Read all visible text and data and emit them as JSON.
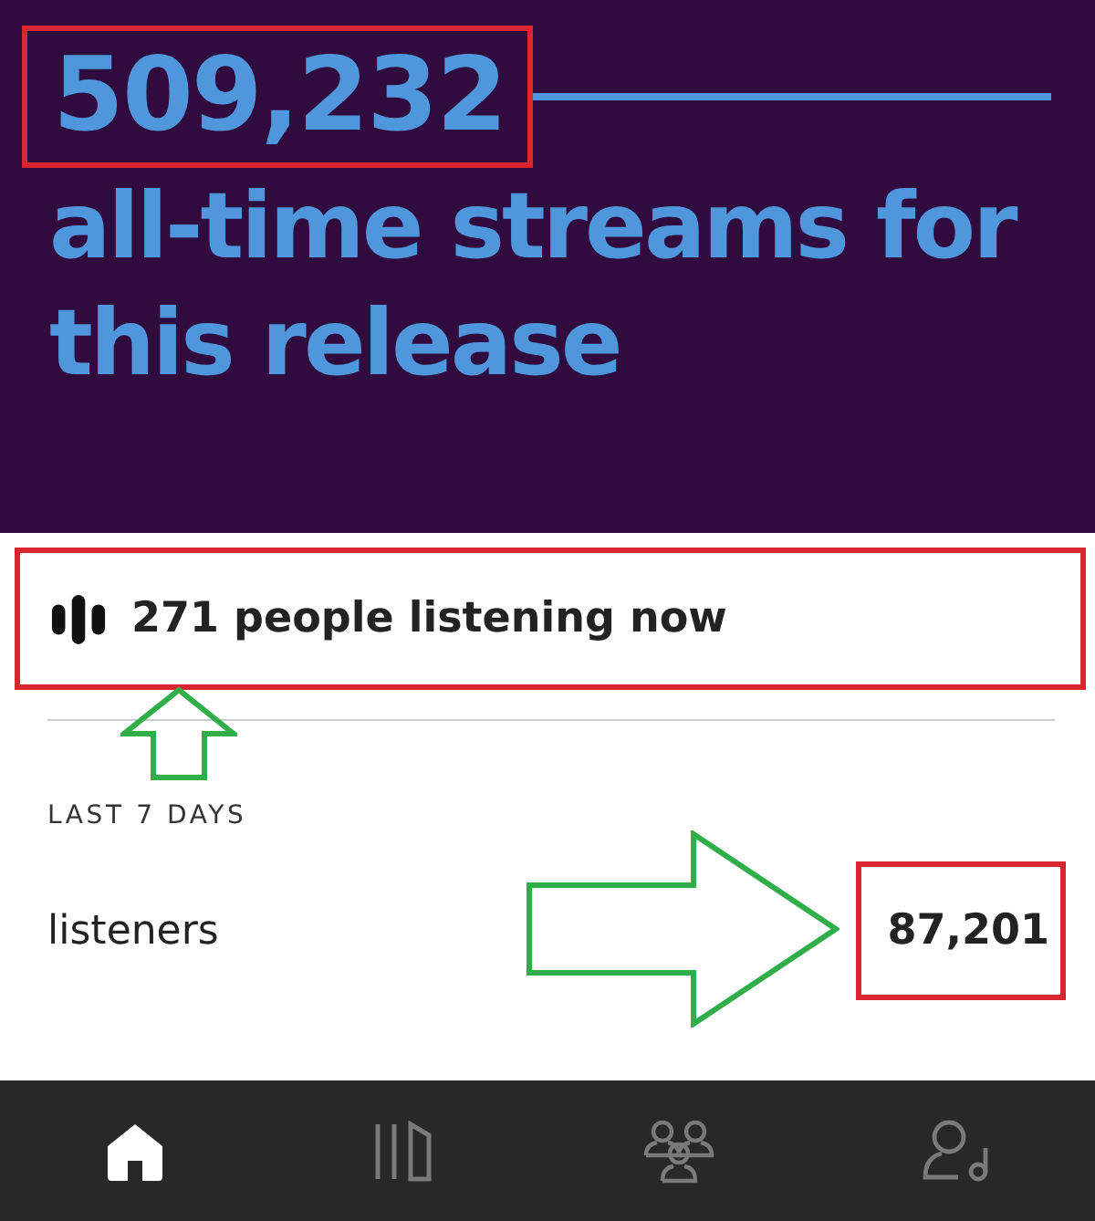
{
  "hero": {
    "count": "509,232",
    "count_highlighted": true,
    "caption": "all-time streams for this release"
  },
  "live": {
    "text": "271 people listening now",
    "highlighted": true,
    "arrow_below": true
  },
  "period": "LAST 7 DAYS",
  "stats": [
    {
      "label": "listeners",
      "value": "87,201",
      "highlighted": true,
      "arrow_before": true
    }
  ],
  "nav": [
    {
      "kind": "home",
      "selected": true
    },
    {
      "kind": "library",
      "selected": false
    },
    {
      "kind": "audience",
      "selected": false
    },
    {
      "kind": "artist",
      "selected": false
    }
  ]
}
